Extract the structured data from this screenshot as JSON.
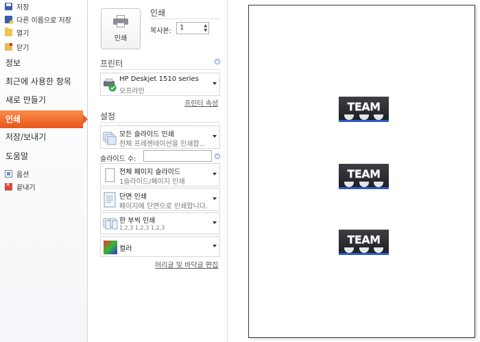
{
  "nav": {
    "top_items": [
      {
        "label": "저장",
        "icon": "save-icon"
      },
      {
        "label": "다른 이름으로 저장",
        "icon": "save-as-icon"
      },
      {
        "label": "열기",
        "icon": "open-folder-icon"
      },
      {
        "label": "닫기",
        "icon": "close-file-icon"
      }
    ],
    "main_items": [
      {
        "label": "정보"
      },
      {
        "label": "최근에 사용한 항목"
      },
      {
        "label": "새로 만들기"
      },
      {
        "label": "인쇄",
        "active": true
      },
      {
        "label": "저장/보내기"
      },
      {
        "label": "도움말"
      }
    ],
    "bottom_items": [
      {
        "label": "옵션",
        "icon": "options-icon"
      },
      {
        "label": "끝내기",
        "icon": "exit-icon"
      }
    ],
    "accent_color": "#e8561a"
  },
  "print": {
    "section_title": "인쇄",
    "button_label": "인쇄",
    "copies_label": "복사본:",
    "copies_value": "1"
  },
  "printer": {
    "section_title": "프린터",
    "name": "HP Deskjet 1510 series",
    "status": "오프라인",
    "properties_link": "프린터 속성"
  },
  "settings": {
    "section_title": "설정",
    "range": {
      "title": "모든 슬라이드 인쇄",
      "sub": "전체 프레젠테이션을 인쇄합..."
    },
    "slides_label": "슬라이드 수:",
    "slides_value": "",
    "layout": {
      "title": "전체 페이지 슬라이드",
      "sub": "1슬라이드/페이지 인쇄"
    },
    "sides": {
      "title": "단면 인쇄",
      "sub": "페이지에 단면으로 인쇄합니다."
    },
    "collate": {
      "title": "한 부씩 인쇄",
      "sub": "1,2,3     1,2,3     1,2,3"
    },
    "color": {
      "title": "컬러"
    },
    "header_footer_link": "머리글 및 바닥글 편집"
  },
  "preview": {
    "images": [
      {
        "text": "TEAM"
      },
      {
        "text": "TEAM"
      },
      {
        "text": "TEAM"
      }
    ]
  }
}
